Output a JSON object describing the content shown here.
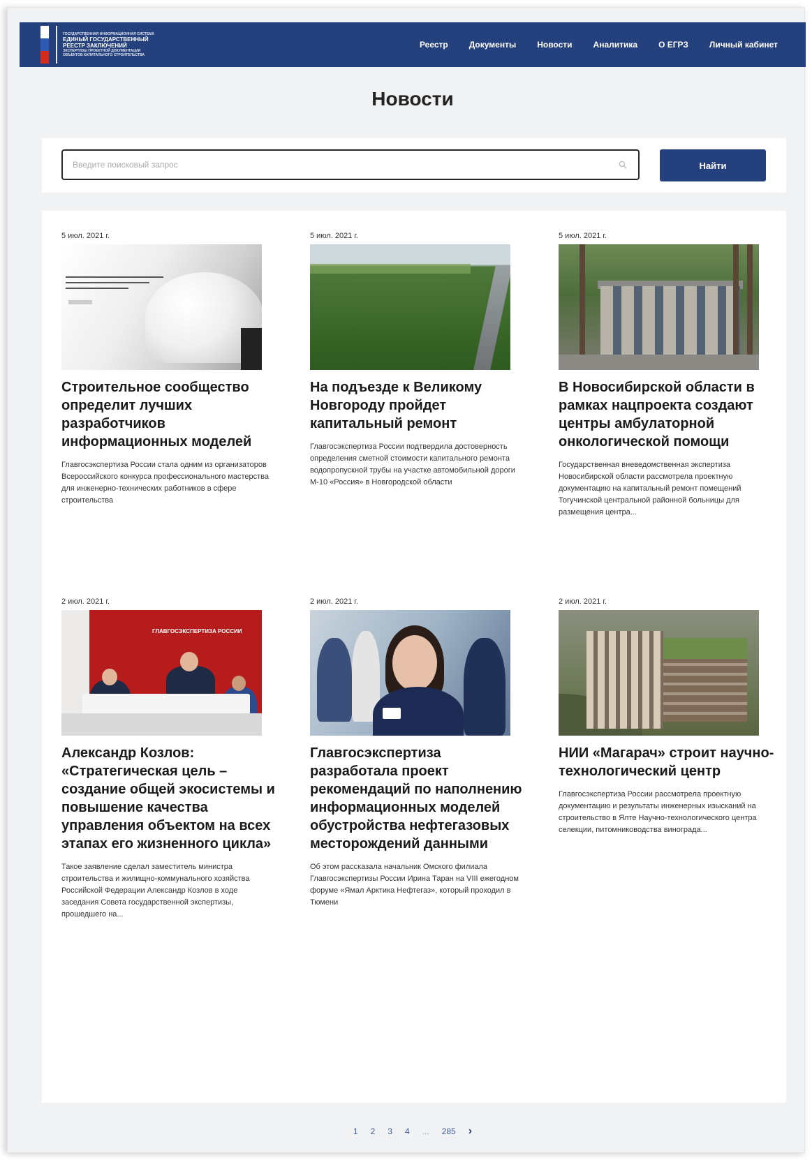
{
  "header": {
    "logo_lines": [
      "ГОСУДАРСТВЕННАЯ ИНФОРМАЦИОННАЯ СИСТЕМА",
      "ЕДИНЫЙ ГОСУДАРСТВЕННЫЙ",
      "РЕЕСТР ЗАКЛЮЧЕНИЙ",
      "ЭКСПЕРТИЗЫ ПРОЕКТНОЙ ДОКУМЕНТАЦИИ",
      "ОБЪЕКТОВ КАПИТАЛЬНОГО СТРОИТЕЛЬСТВА"
    ],
    "nav": [
      "Реестр",
      "Документы",
      "Новости",
      "Аналитика",
      "О ЕГРЗ",
      "Личный кабинет"
    ],
    "brand_color": "#24407d"
  },
  "page_title": "Новости",
  "search": {
    "placeholder": "Введите поисковый запрос",
    "value": "",
    "button_label": "Найти"
  },
  "news": [
    {
      "date": "5 июл. 2021 г.",
      "title": "Строительное сообщество определит лучших разработчиков информационных моделей",
      "summary": "Главгосэкспертиза России стала одним из организаторов Всероссийского конкурса профессионального мастерства для инженерно-технических работников в сфере строительства"
    },
    {
      "date": "5 июл. 2021 г.",
      "title": "На подъезде к Великому Новгороду пройдет капитальный ремонт",
      "summary": "Главгосэкспертиза России подтвердила достоверность определения сметной стоимости капитального ремонта водопропускной трубы на участке автомобильной дороги М-10 «Россия» в Новгородской области"
    },
    {
      "date": "5 июл. 2021 г.",
      "title": "В Новосибирской области в рамках нацпроекта создают центры амбулаторной онкологической помощи",
      "summary": "Государственная вневедомственная экспертиза Новосибирской области рассмотрела проектную документацию на капитальный ремонт помещений Тогучинской центральной районной больницы для размещения центра..."
    },
    {
      "date": "2 июл. 2021 г.",
      "title": "Александр Козлов: «Стратегическая цель – создание общей экосистемы и повышение качества управления объектом на всех этапах его жизненного цикла»",
      "summary": "Такое заявление сделал заместитель министра строительства и жилищно-коммунального хозяйства Российской Федерации Александр Козлов в ходе заседания Совета государственной экспертизы, прошедшего на...",
      "image_text": "ГЛАВГОСЭКСПЕРТИЗА РОССИИ"
    },
    {
      "date": "2 июл. 2021 г.",
      "title": "Главгосэкспертиза разработала проект рекомендаций по наполнению информационных моделей обустройства нефтегазовых месторождений данными",
      "summary": "Об этом рассказала начальник Омского филиала Главгосэкспертизы России Ирина Таран на VIII ежегодном форуме «Ямал Арктика Нефтегаз», который проходил в Тюмени"
    },
    {
      "date": "2 июл. 2021 г.",
      "title": "НИИ «Магарач» строит научно-технологический центр",
      "summary": "Главгосэкспертиза России рассмотрела проектную документацию и результаты инженерных изысканий на строительство в Ялте Научно-технологического центра селекции, питомниководства винограда..."
    }
  ],
  "pagination": {
    "pages": [
      "1",
      "2",
      "3",
      "4"
    ],
    "ellipsis": "...",
    "last": "285",
    "next": "›"
  }
}
